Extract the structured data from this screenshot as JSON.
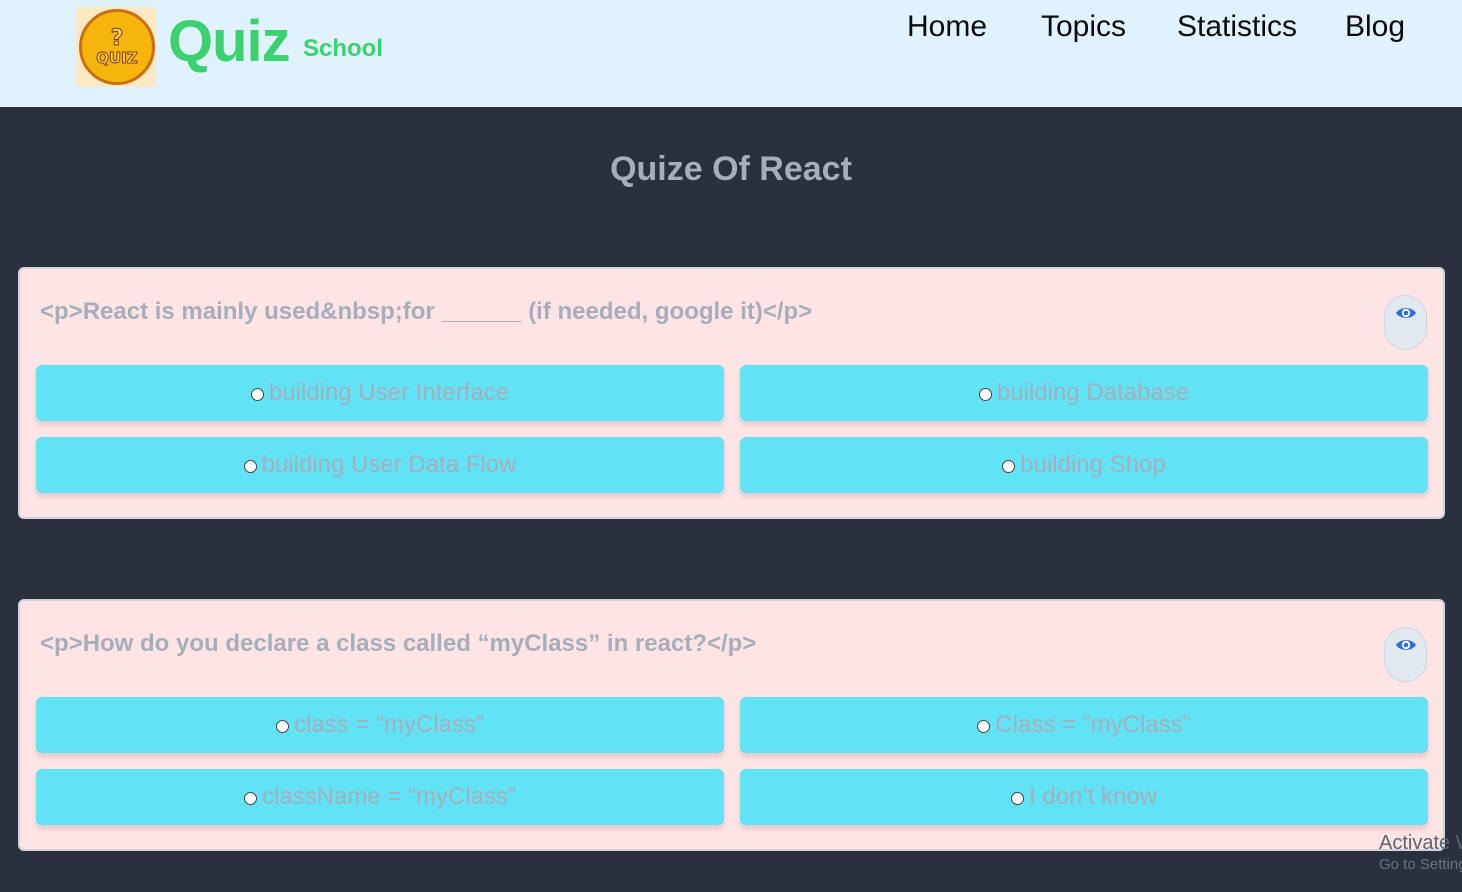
{
  "brand": {
    "main": "Quiz",
    "sub": "School",
    "logo_q": "?",
    "logo_word": "QUIZ"
  },
  "nav": {
    "home": "Home",
    "topics": "Topics",
    "statistics": "Statistics",
    "blog": "Blog"
  },
  "page_title": "Quize Of React",
  "quizzes": [
    {
      "question": "<p>React is mainly used&nbsp;for ______ (if needed, google it)</p>",
      "options": [
        "building User Interface",
        "building Database",
        "building User Data Flow",
        "building Shop"
      ]
    },
    {
      "question": "<p>How do you declare a class called “myClass” in react?</p>",
      "options": [
        "class = “myClass”",
        "Class = “myClass”",
        "className = “myClass”",
        "I don’t know"
      ]
    }
  ],
  "watermark": {
    "line1": "Activate W",
    "line2": "Go to Settings"
  },
  "colors": {
    "navbar_bg": "#e0f2fe",
    "page_bg": "#2a303c",
    "card_bg": "#ffe4e6",
    "option_bg": "#61e3f5",
    "brand_green": "#3ad16e",
    "eye_blue": "#2b6fe0",
    "muted_text": "#a6adbb"
  },
  "icons": {
    "eye": "eye-icon",
    "radio": "radio-empty-icon",
    "logo": "quiz-coin-logo"
  }
}
